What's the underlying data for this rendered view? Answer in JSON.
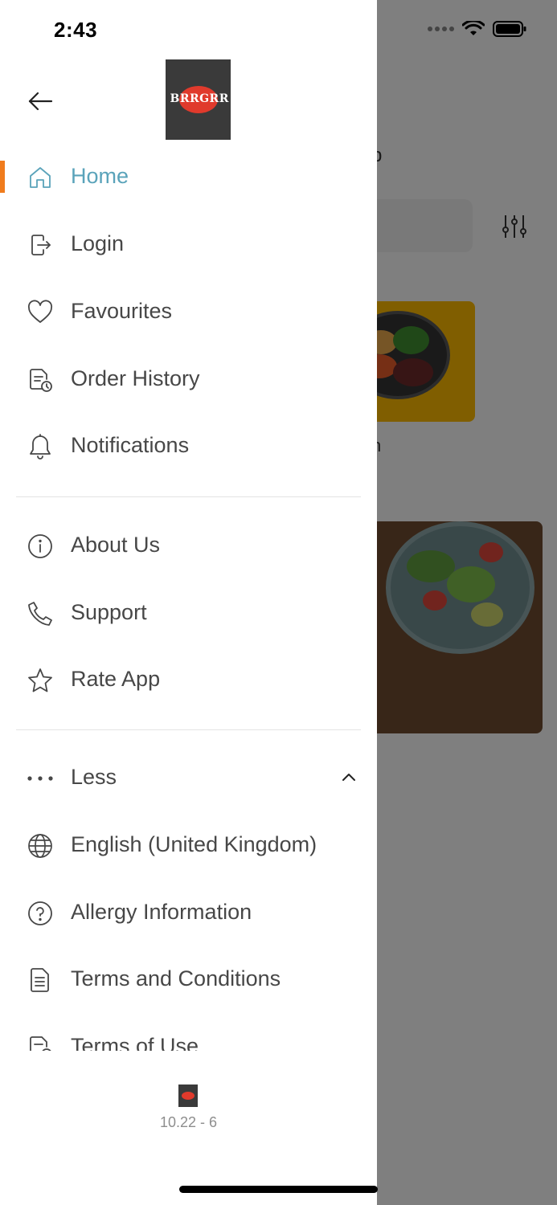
{
  "status_bar": {
    "time": "2:43"
  },
  "drawer": {
    "brand": {
      "logo_text": "BRRGRR"
    },
    "menu_primary": [
      {
        "key": "home",
        "label": "Home",
        "icon": "home-icon",
        "active": true
      },
      {
        "key": "login",
        "label": "Login",
        "icon": "login-icon"
      },
      {
        "key": "favourites",
        "label": "Favourites",
        "icon": "heart-icon"
      },
      {
        "key": "order_history",
        "label": "Order History",
        "icon": "order-history-icon"
      },
      {
        "key": "notifications",
        "label": "Notifications",
        "icon": "bell-icon"
      }
    ],
    "menu_secondary": [
      {
        "key": "about",
        "label": "About Us",
        "icon": "info-icon"
      },
      {
        "key": "support",
        "label": "Support",
        "icon": "phone-icon"
      },
      {
        "key": "rate",
        "label": "Rate App",
        "icon": "star-icon"
      }
    ],
    "menu_more": {
      "toggle_label": "Less",
      "items": [
        {
          "key": "language",
          "label": "English (United Kingdom)",
          "icon": "globe-icon"
        },
        {
          "key": "allergy",
          "label": "Allergy Information",
          "icon": "question-circle-icon"
        },
        {
          "key": "terms_conditions",
          "label": "Terms and Conditions",
          "icon": "document-icon"
        },
        {
          "key": "terms_use",
          "label": "Terms of Use",
          "icon": "document-history-icon"
        }
      ]
    },
    "footer": {
      "version": "10.22 - 6"
    }
  },
  "background_app": {
    "heading_fragment": "p",
    "card1_label_fragment": "n"
  },
  "colors": {
    "active_text": "#5aa3ba",
    "active_indicator": "#f07c1d",
    "text": "#474747",
    "divider": "#e3e3e3"
  }
}
